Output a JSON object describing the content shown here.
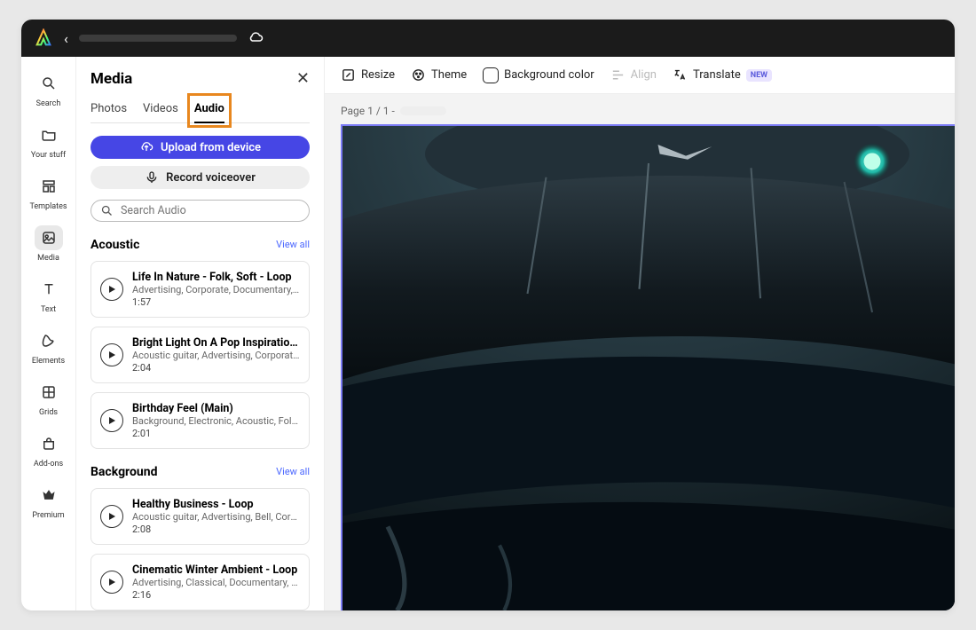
{
  "rail": [
    {
      "id": "search",
      "label": "Search"
    },
    {
      "id": "your-stuff",
      "label": "Your stuff"
    },
    {
      "id": "templates",
      "label": "Templates"
    },
    {
      "id": "media",
      "label": "Media"
    },
    {
      "id": "text",
      "label": "Text"
    },
    {
      "id": "elements",
      "label": "Elements"
    },
    {
      "id": "grids",
      "label": "Grids"
    },
    {
      "id": "addons",
      "label": "Add-ons"
    },
    {
      "id": "premium",
      "label": "Premium"
    }
  ],
  "panel": {
    "title": "Media",
    "tabs": {
      "photos": "Photos",
      "videos": "Videos",
      "audio": "Audio"
    },
    "upload_label": "Upload from device",
    "record_label": "Record voiceover",
    "search_placeholder": "Search Audio",
    "view_all": "View all",
    "sections": [
      {
        "title": "Acoustic",
        "tracks": [
          {
            "title": "Life In Nature - Folk, Soft - Loop",
            "tags": "Advertising, Corporate, Documentary, D…",
            "dur": "1:57"
          },
          {
            "title": "Bright Light On A Pop Inspiratio…",
            "tags": "Acoustic guitar, Advertising, Corporate, …",
            "dur": "2:04"
          },
          {
            "title": "Birthday Feel (Main)",
            "tags": "Background, Electronic, Acoustic, Folk, …",
            "dur": "2:01"
          }
        ]
      },
      {
        "title": "Background",
        "tracks": [
          {
            "title": "Healthy Business - Loop",
            "tags": "Acoustic guitar, Advertising, Bell, Corpor…",
            "dur": "2:08"
          },
          {
            "title": "Cinematic Winter Ambient - Loop",
            "tags": "Advertising, Classical, Documentary, Dr…",
            "dur": "2:16"
          }
        ]
      }
    ]
  },
  "toolbar": {
    "resize": "Resize",
    "theme": "Theme",
    "background": "Background color",
    "align": "Align",
    "translate": "Translate",
    "badge": "NEW"
  },
  "page_label": "Page 1 / 1 -",
  "colors": {
    "primary": "#4646e5",
    "highlight": "#e8871e"
  }
}
